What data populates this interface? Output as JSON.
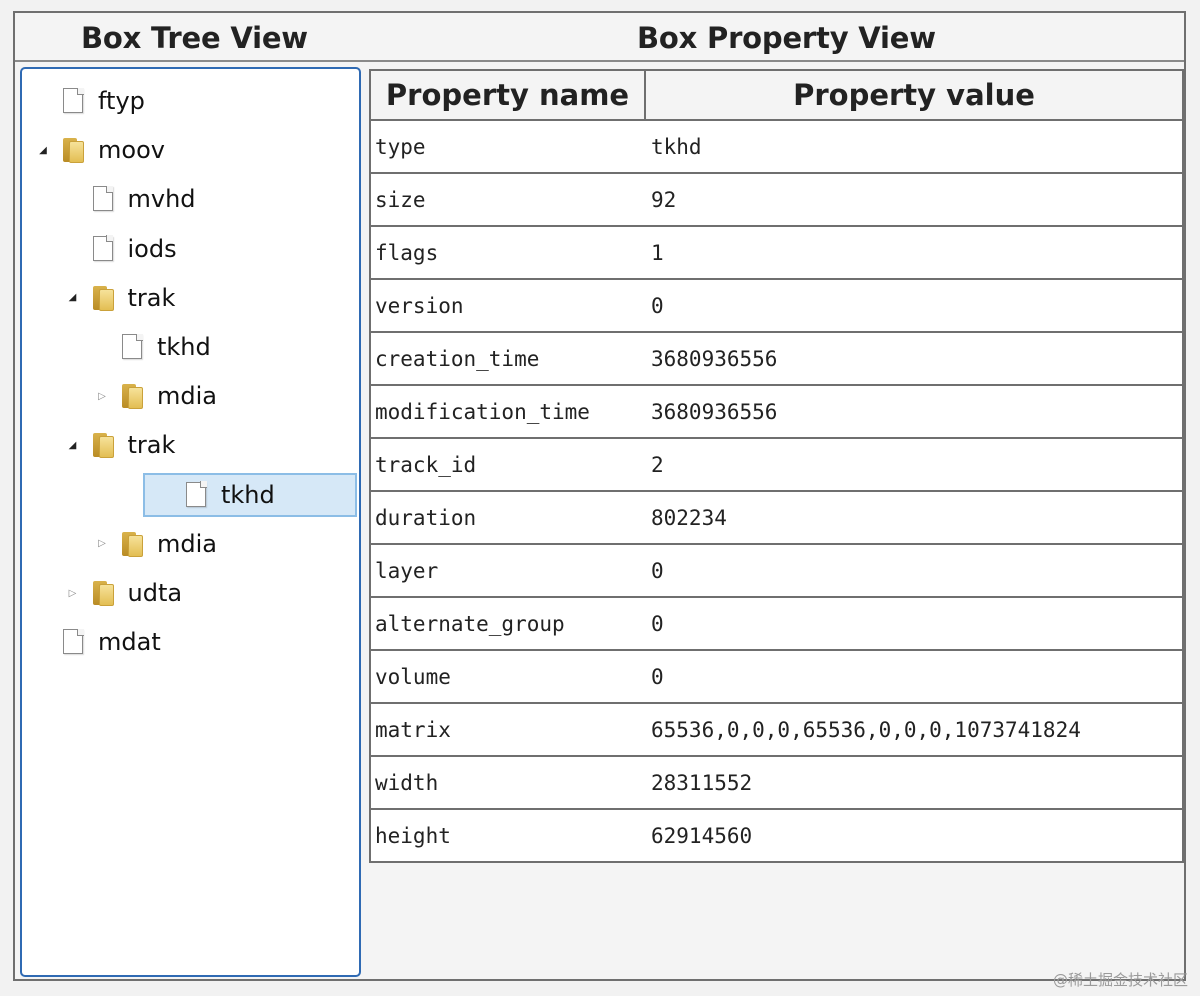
{
  "header": {
    "tree_title": "Box Tree View",
    "property_title": "Box Property View"
  },
  "tree": [
    {
      "label": "ftyp",
      "type": "file",
      "depth": 0,
      "toggle": "none"
    },
    {
      "label": "moov",
      "type": "folder",
      "depth": 0,
      "toggle": "open"
    },
    {
      "label": "mvhd",
      "type": "file",
      "depth": 1,
      "toggle": "none"
    },
    {
      "label": "iods",
      "type": "file",
      "depth": 1,
      "toggle": "none"
    },
    {
      "label": "trak",
      "type": "folder",
      "depth": 1,
      "toggle": "open"
    },
    {
      "label": "tkhd",
      "type": "file",
      "depth": 2,
      "toggle": "none"
    },
    {
      "label": "mdia",
      "type": "folder",
      "depth": 2,
      "toggle": "closed"
    },
    {
      "label": "trak",
      "type": "folder",
      "depth": 1,
      "toggle": "open"
    },
    {
      "label": "tkhd",
      "type": "file",
      "depth": 2,
      "toggle": "none",
      "selected": true
    },
    {
      "label": "mdia",
      "type": "folder",
      "depth": 2,
      "toggle": "closed"
    },
    {
      "label": "udta",
      "type": "folder",
      "depth": 1,
      "toggle": "closed"
    },
    {
      "label": "mdat",
      "type": "file",
      "depth": 0,
      "toggle": "none"
    }
  ],
  "properties": {
    "columns": [
      "Property name",
      "Property value"
    ],
    "rows": [
      [
        "type",
        "tkhd"
      ],
      [
        "size",
        "92"
      ],
      [
        "flags",
        "1"
      ],
      [
        "version",
        "0"
      ],
      [
        "creation_time",
        "3680936556"
      ],
      [
        "modification_time",
        "3680936556"
      ],
      [
        "track_id",
        "2"
      ],
      [
        "duration",
        "802234"
      ],
      [
        "layer",
        "0"
      ],
      [
        "alternate_group",
        "0"
      ],
      [
        "volume",
        "0"
      ],
      [
        "matrix",
        "65536,0,0,0,65536,0,0,0,1073741824"
      ],
      [
        "width",
        "28311552"
      ],
      [
        "height",
        "62914560"
      ]
    ]
  },
  "watermark": "@稀土掘金技术社区"
}
